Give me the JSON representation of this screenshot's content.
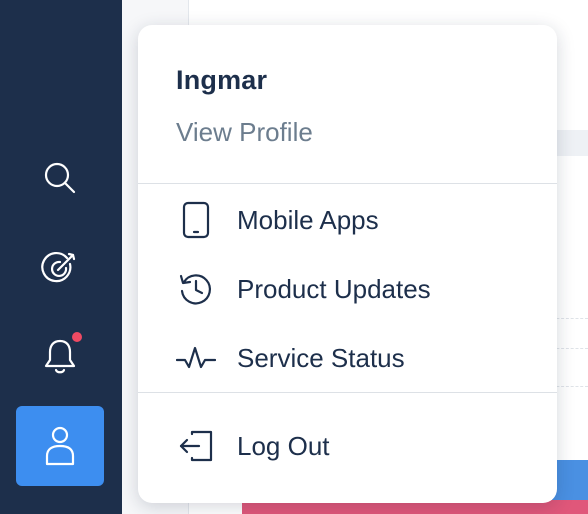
{
  "sidebar": {
    "items": [
      {
        "icon": "search-icon",
        "active": false
      },
      {
        "icon": "target-icon",
        "active": false
      },
      {
        "icon": "bell-icon",
        "active": false,
        "has_notification": true
      },
      {
        "icon": "user-icon",
        "active": true
      }
    ],
    "colors": {
      "background": "#1d2f4b",
      "active": "#3d8ef0",
      "notification_dot": "#ef4a63",
      "icon": "#ffffff"
    }
  },
  "menu": {
    "user_name": "Ingmar",
    "profile_link": "View Profile",
    "items": [
      {
        "icon": "mobile-phone-icon",
        "label": "Mobile Apps"
      },
      {
        "icon": "history-clock-icon",
        "label": "Product Updates"
      },
      {
        "icon": "pulse-icon",
        "label": "Service Status"
      }
    ],
    "logout": {
      "icon": "log-out-icon",
      "label": "Log Out"
    },
    "colors": {
      "text": "#1d2f4b",
      "muted": "#6c7d8e"
    }
  }
}
